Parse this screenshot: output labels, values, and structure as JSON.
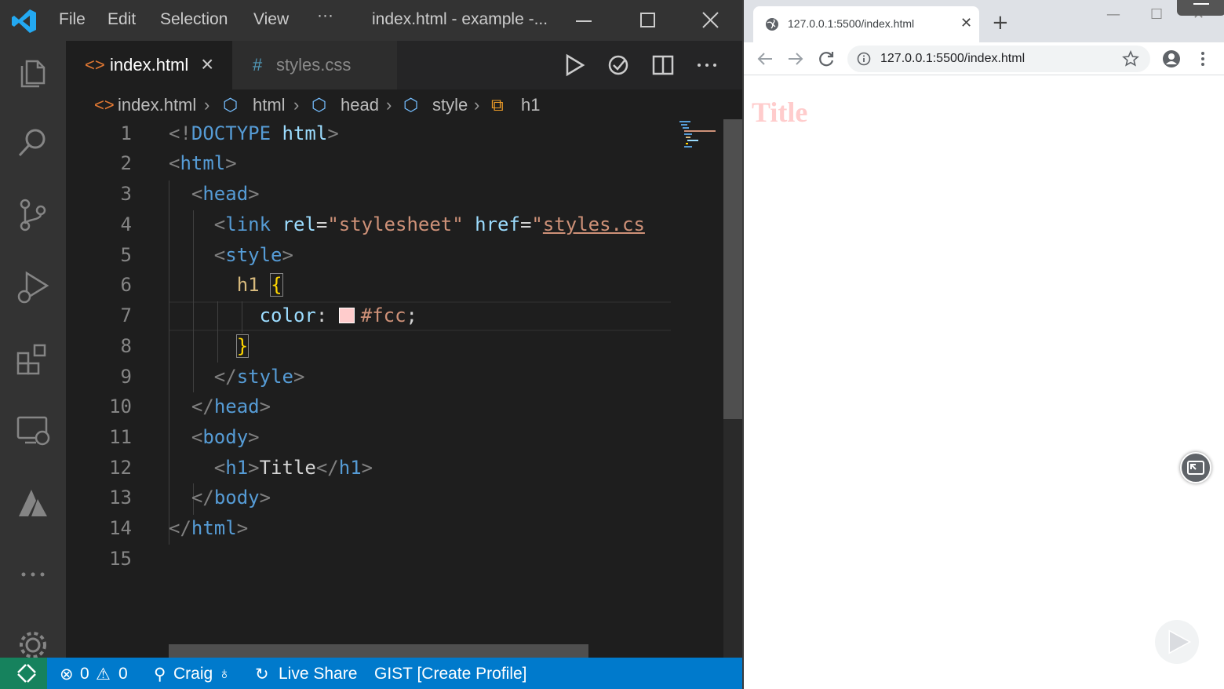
{
  "vscode": {
    "menu": [
      "File",
      "Edit",
      "Selection",
      "View",
      "···"
    ],
    "window_title": "index.html - example -...",
    "tabs": [
      {
        "label": "index.html",
        "icon": "<>",
        "active": true
      },
      {
        "label": "styles.css",
        "icon": "#",
        "active": false
      }
    ],
    "breadcrumb": [
      "index.html",
      "html",
      "head",
      "style",
      "h1"
    ],
    "code_lines": [
      "<!DOCTYPE html>",
      "<html>",
      "  <head>",
      "    <link rel=\"stylesheet\" href=\"styles.cs",
      "    <style>",
      "      h1 {",
      "        color: #fcc;",
      "      }",
      "    </style>",
      "  </head>",
      "  <body>",
      "    <h1>Title</h1>",
      "  </body>",
      "</html>",
      ""
    ],
    "line_numbers": [
      "1",
      "2",
      "3",
      "4",
      "5",
      "6",
      "7",
      "8",
      "9",
      "10",
      "11",
      "12",
      "13",
      "14",
      "15"
    ],
    "color_swatch": "#ffcccc",
    "status": {
      "errors": "0",
      "warnings": "0",
      "user": "Craig",
      "live_share": "Live Share",
      "gist": "GIST [Create Profile]"
    },
    "colors": {
      "titlebar": "#333333",
      "activitybar": "#333333",
      "editor_bg": "#1e1e1e",
      "statusbar": "#007acc",
      "remote": "#16825d",
      "logo": "#23a9f2"
    }
  },
  "browser": {
    "tab_title": "127.0.0.1:5500/index.html",
    "url": "127.0.0.1:5500/index.html",
    "page_heading": "Title",
    "heading_color": "#ffcccc"
  }
}
